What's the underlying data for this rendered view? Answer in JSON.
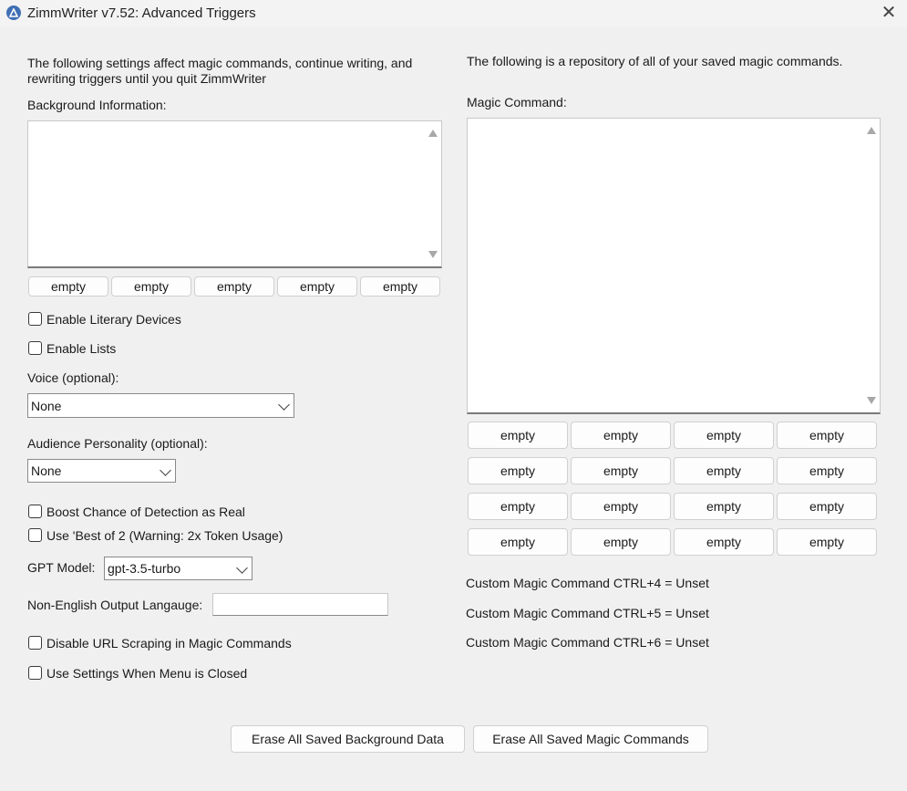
{
  "window": {
    "title": "ZimmWriter v7.52: Advanced Triggers",
    "close_glyph": "✕"
  },
  "left": {
    "intro": "The following settings affect magic commands, continue writing, and rewriting triggers until you quit ZimmWriter",
    "background_label": "Background Information:",
    "background_value": "",
    "slots": [
      "empty",
      "empty",
      "empty",
      "empty",
      "empty"
    ],
    "enable_literary_devices": "Enable Literary Devices",
    "enable_lists": "Enable Lists",
    "voice_label": "Voice (optional):",
    "voice_value": "None",
    "audience_label": "Audience Personality (optional):",
    "audience_value": "None",
    "boost_detection": "Boost Chance of Detection as Real",
    "best_of_2": "Use 'Best of 2 (Warning: 2x Token Usage)",
    "gpt_model_label": "GPT Model:",
    "gpt_model_value": "gpt-3.5-turbo",
    "non_english_label": "Non-English Output Langauge:",
    "non_english_value": "",
    "disable_url_scraping": "Disable URL Scraping in Magic Commands",
    "use_settings_closed": "Use Settings When Menu is Closed"
  },
  "right": {
    "intro": "The following is a repository of all of your saved magic commands.",
    "magic_label": "Magic Command:",
    "magic_value": "",
    "grid": [
      [
        "empty",
        "empty",
        "empty",
        "empty"
      ],
      [
        "empty",
        "empty",
        "empty",
        "empty"
      ],
      [
        "empty",
        "empty",
        "empty",
        "empty"
      ],
      [
        "empty",
        "empty",
        "empty",
        "empty"
      ]
    ],
    "custom_4": "Custom Magic Command CTRL+4 = Unset",
    "custom_5": "Custom Magic Command CTRL+5 = Unset",
    "custom_6": "Custom Magic Command CTRL+6 = Unset"
  },
  "footer": {
    "erase_background": "Erase All Saved Background Data",
    "erase_magic": "Erase All Saved Magic Commands"
  }
}
